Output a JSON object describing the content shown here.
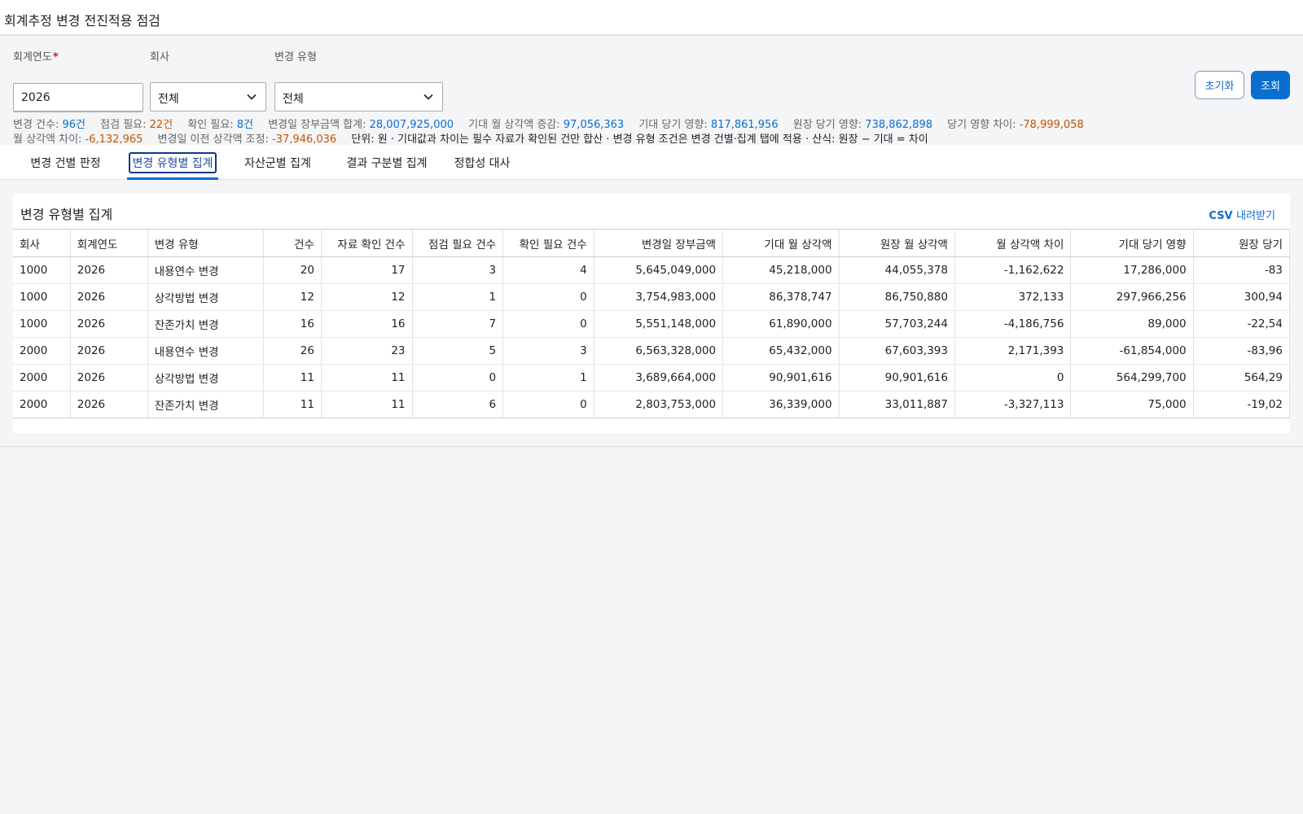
{
  "app": {
    "title": "회계추정 변경 전진적용 점검"
  },
  "filters": {
    "year": {
      "label": "회계연도",
      "required_mark": "*",
      "value": "2026"
    },
    "company": {
      "label": "회사",
      "value": "전체"
    },
    "change_type": {
      "label": "변경 유형",
      "value": "전체"
    }
  },
  "buttons": {
    "reset": "초기화",
    "search": "조회"
  },
  "summary": {
    "change_count": {
      "label": "변경 건수:",
      "value": "96건"
    },
    "review_needed": {
      "label": "점검 필요:",
      "value": "22건"
    },
    "confirm_needed": {
      "label": "확인 필요:",
      "value": "8건"
    },
    "book_value_total": {
      "label": "변경일 장부금액 합계:",
      "value": "28,007,925,000"
    },
    "expected_monthly_increase": {
      "label": "기대 월 상각액 증감:",
      "value": "97,056,363"
    },
    "expected_period_impact": {
      "label": "기대 당기 영향:",
      "value": "817,861,956"
    },
    "ledger_period_impact": {
      "label": "원장 당기 영향:",
      "value": "738,862,898"
    },
    "period_impact_diff": {
      "label": "당기 영향 차이:",
      "value": "-78,999,058"
    },
    "monthly_diff": {
      "label": "월 상각액 차이:",
      "value": "-6,132,965"
    },
    "prior_adjustment": {
      "label": "변경일 이전 상각액 조정:",
      "value": "-37,946,036"
    },
    "note": "단위: 원 · 기대값과 차이는 필수 자료가 확인된 건만 합산 · 변경 유형 조건은 변경 건별·집계 탭에 적용 · 산식: 원장 − 기대 = 차이"
  },
  "tabs": [
    {
      "label": "변경 건별 판정"
    },
    {
      "label": "변경 유형별 집계"
    },
    {
      "label": "자산군별 집계"
    },
    {
      "label": "결과 구분별 집계"
    },
    {
      "label": "정합성 대사"
    }
  ],
  "panel": {
    "title": "변경 유형별 집계",
    "csv_bold": "CSV",
    "csv_rest": "내려받기"
  },
  "table": {
    "columns": [
      "회사",
      "회계연도",
      "변경 유형",
      "건수",
      "자료 확인 건수",
      "점검 필요 건수",
      "확인 필요 건수",
      "변경일 장부금액",
      "기대 월 상각액",
      "원장 월 상각액",
      "월 상각액 차이",
      "기대 당기 영향",
      "원장 당기"
    ],
    "rows": [
      [
        "1000",
        "2026",
        "내용연수 변경",
        "20",
        "17",
        "3",
        "4",
        "5,645,049,000",
        "45,218,000",
        "44,055,378",
        "-1,162,622",
        "17,286,000",
        "-83"
      ],
      [
        "1000",
        "2026",
        "상각방법 변경",
        "12",
        "12",
        "1",
        "0",
        "3,754,983,000",
        "86,378,747",
        "86,750,880",
        "372,133",
        "297,966,256",
        "300,94"
      ],
      [
        "1000",
        "2026",
        "잔존가치 변경",
        "16",
        "16",
        "7",
        "0",
        "5,551,148,000",
        "61,890,000",
        "57,703,244",
        "-4,186,756",
        "89,000",
        "-22,54"
      ],
      [
        "2000",
        "2026",
        "내용연수 변경",
        "26",
        "23",
        "5",
        "3",
        "6,563,328,000",
        "65,432,000",
        "67,603,393",
        "2,171,393",
        "-61,854,000",
        "-83,96"
      ],
      [
        "2000",
        "2026",
        "상각방법 변경",
        "11",
        "11",
        "0",
        "1",
        "3,689,664,000",
        "90,901,616",
        "90,901,616",
        "0",
        "564,299,700",
        "564,29"
      ],
      [
        "2000",
        "2026",
        "잔존가치 변경",
        "11",
        "11",
        "6",
        "0",
        "2,803,753,000",
        "36,339,000",
        "33,011,887",
        "-3,327,113",
        "75,000",
        "-19,02"
      ]
    ]
  },
  "colors": {
    "accent": "#0a6ed1",
    "warning": "#c35500",
    "required": "#c0203a",
    "active_tab_border": "#0b3a8a"
  },
  "icons": {
    "dropdown": "chevron-down-icon"
  }
}
